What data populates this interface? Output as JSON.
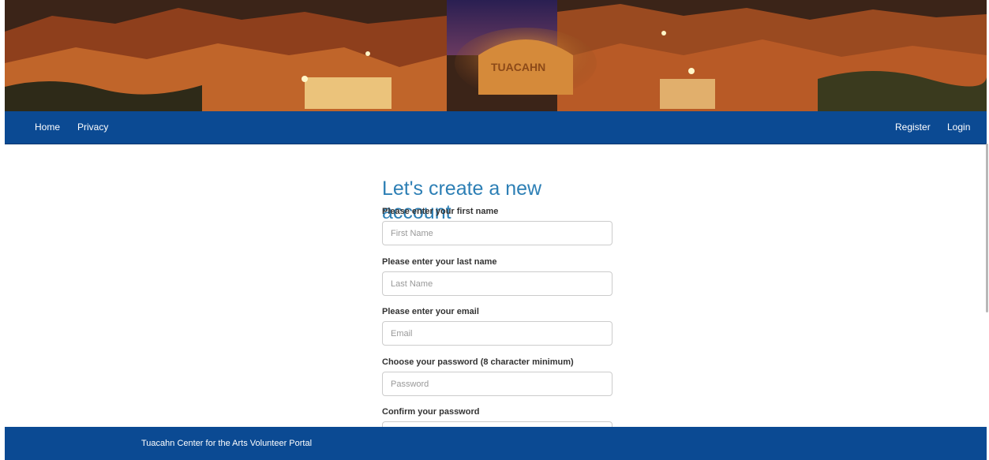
{
  "nav": {
    "left": [
      {
        "label": "Home"
      },
      {
        "label": "Privacy"
      }
    ],
    "right": [
      {
        "label": "Register"
      },
      {
        "label": "Login"
      }
    ]
  },
  "form": {
    "title": "Let's create a new account",
    "fields": [
      {
        "label": "Please enter your first name",
        "placeholder": "First Name",
        "value": ""
      },
      {
        "label": "Please enter your last name",
        "placeholder": "Last Name",
        "value": ""
      },
      {
        "label": "Please enter your email",
        "placeholder": "Email",
        "value": ""
      },
      {
        "label": "Choose your password (8 character minimum)",
        "placeholder": "Password",
        "value": ""
      },
      {
        "label": "Confirm your password",
        "placeholder": "",
        "value": ""
      }
    ]
  },
  "footer": {
    "text": "Tuacahn Center for the Arts Volunteer Portal"
  },
  "colors": {
    "nav_bg": "#0b4a93",
    "title": "#2d7fb5"
  }
}
